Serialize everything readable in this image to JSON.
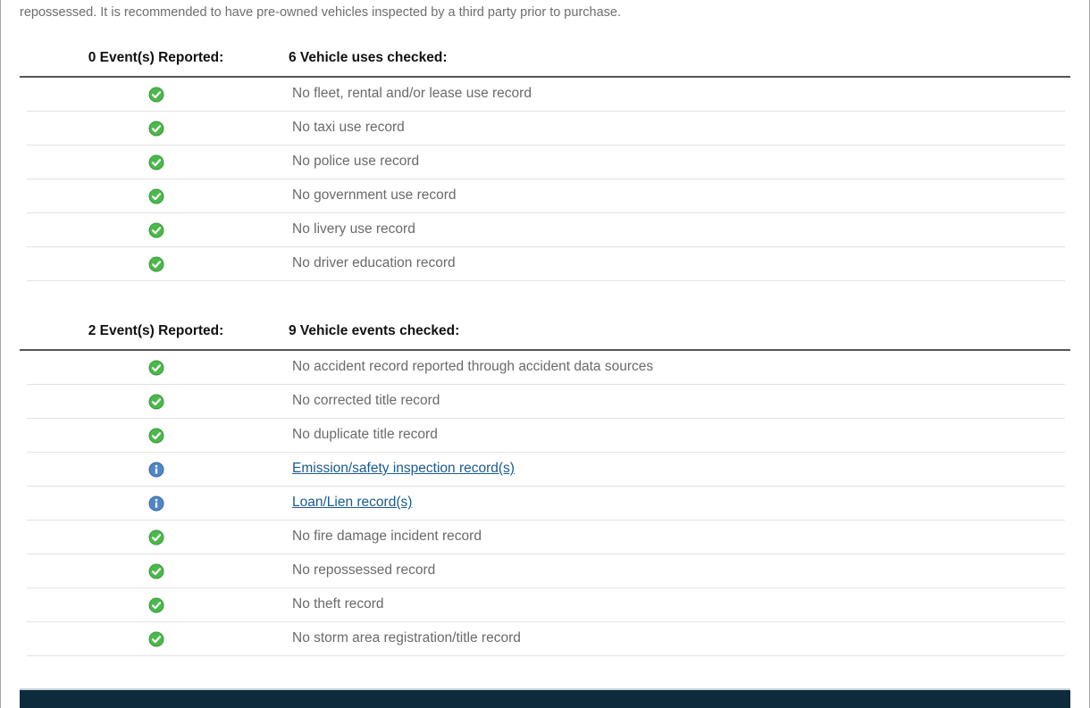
{
  "intro_text": "repossessed. It is recommended to have pre-owned vehicles inspected by a third party prior to purchase.",
  "colors": {
    "ok_green": "#4cb84c",
    "info_blue": "#4f86c6",
    "link": "#1c5a8e",
    "footer_bar": "#0d2b3c"
  },
  "uses_section": {
    "count_label": "0 Event(s) Reported:",
    "checked_label": "6 Vehicle uses checked:",
    "rows": [
      {
        "icon": "check-icon",
        "label": "No fleet, rental and/or lease use record"
      },
      {
        "icon": "check-icon",
        "label": "No taxi use record"
      },
      {
        "icon": "check-icon",
        "label": "No police use record"
      },
      {
        "icon": "check-icon",
        "label": "No government use record"
      },
      {
        "icon": "check-icon",
        "label": "No livery use record"
      },
      {
        "icon": "check-icon",
        "label": "No driver education record"
      }
    ]
  },
  "events_section": {
    "count_label": "2 Event(s) Reported:",
    "checked_label": "9 Vehicle events checked:",
    "rows": [
      {
        "icon": "check-icon",
        "label": "No accident record reported through accident data sources"
      },
      {
        "icon": "check-icon",
        "label": "No corrected title record"
      },
      {
        "icon": "check-icon",
        "label": "No duplicate title record"
      },
      {
        "icon": "info-icon",
        "label": "Emission/safety inspection record(s)"
      },
      {
        "icon": "info-icon",
        "label": "Loan/Lien record(s)"
      },
      {
        "icon": "check-icon",
        "label": "No fire damage incident record"
      },
      {
        "icon": "check-icon",
        "label": "No repossessed record"
      },
      {
        "icon": "check-icon",
        "label": "No theft record"
      },
      {
        "icon": "check-icon",
        "label": "No storm area registration/title record"
      }
    ]
  }
}
